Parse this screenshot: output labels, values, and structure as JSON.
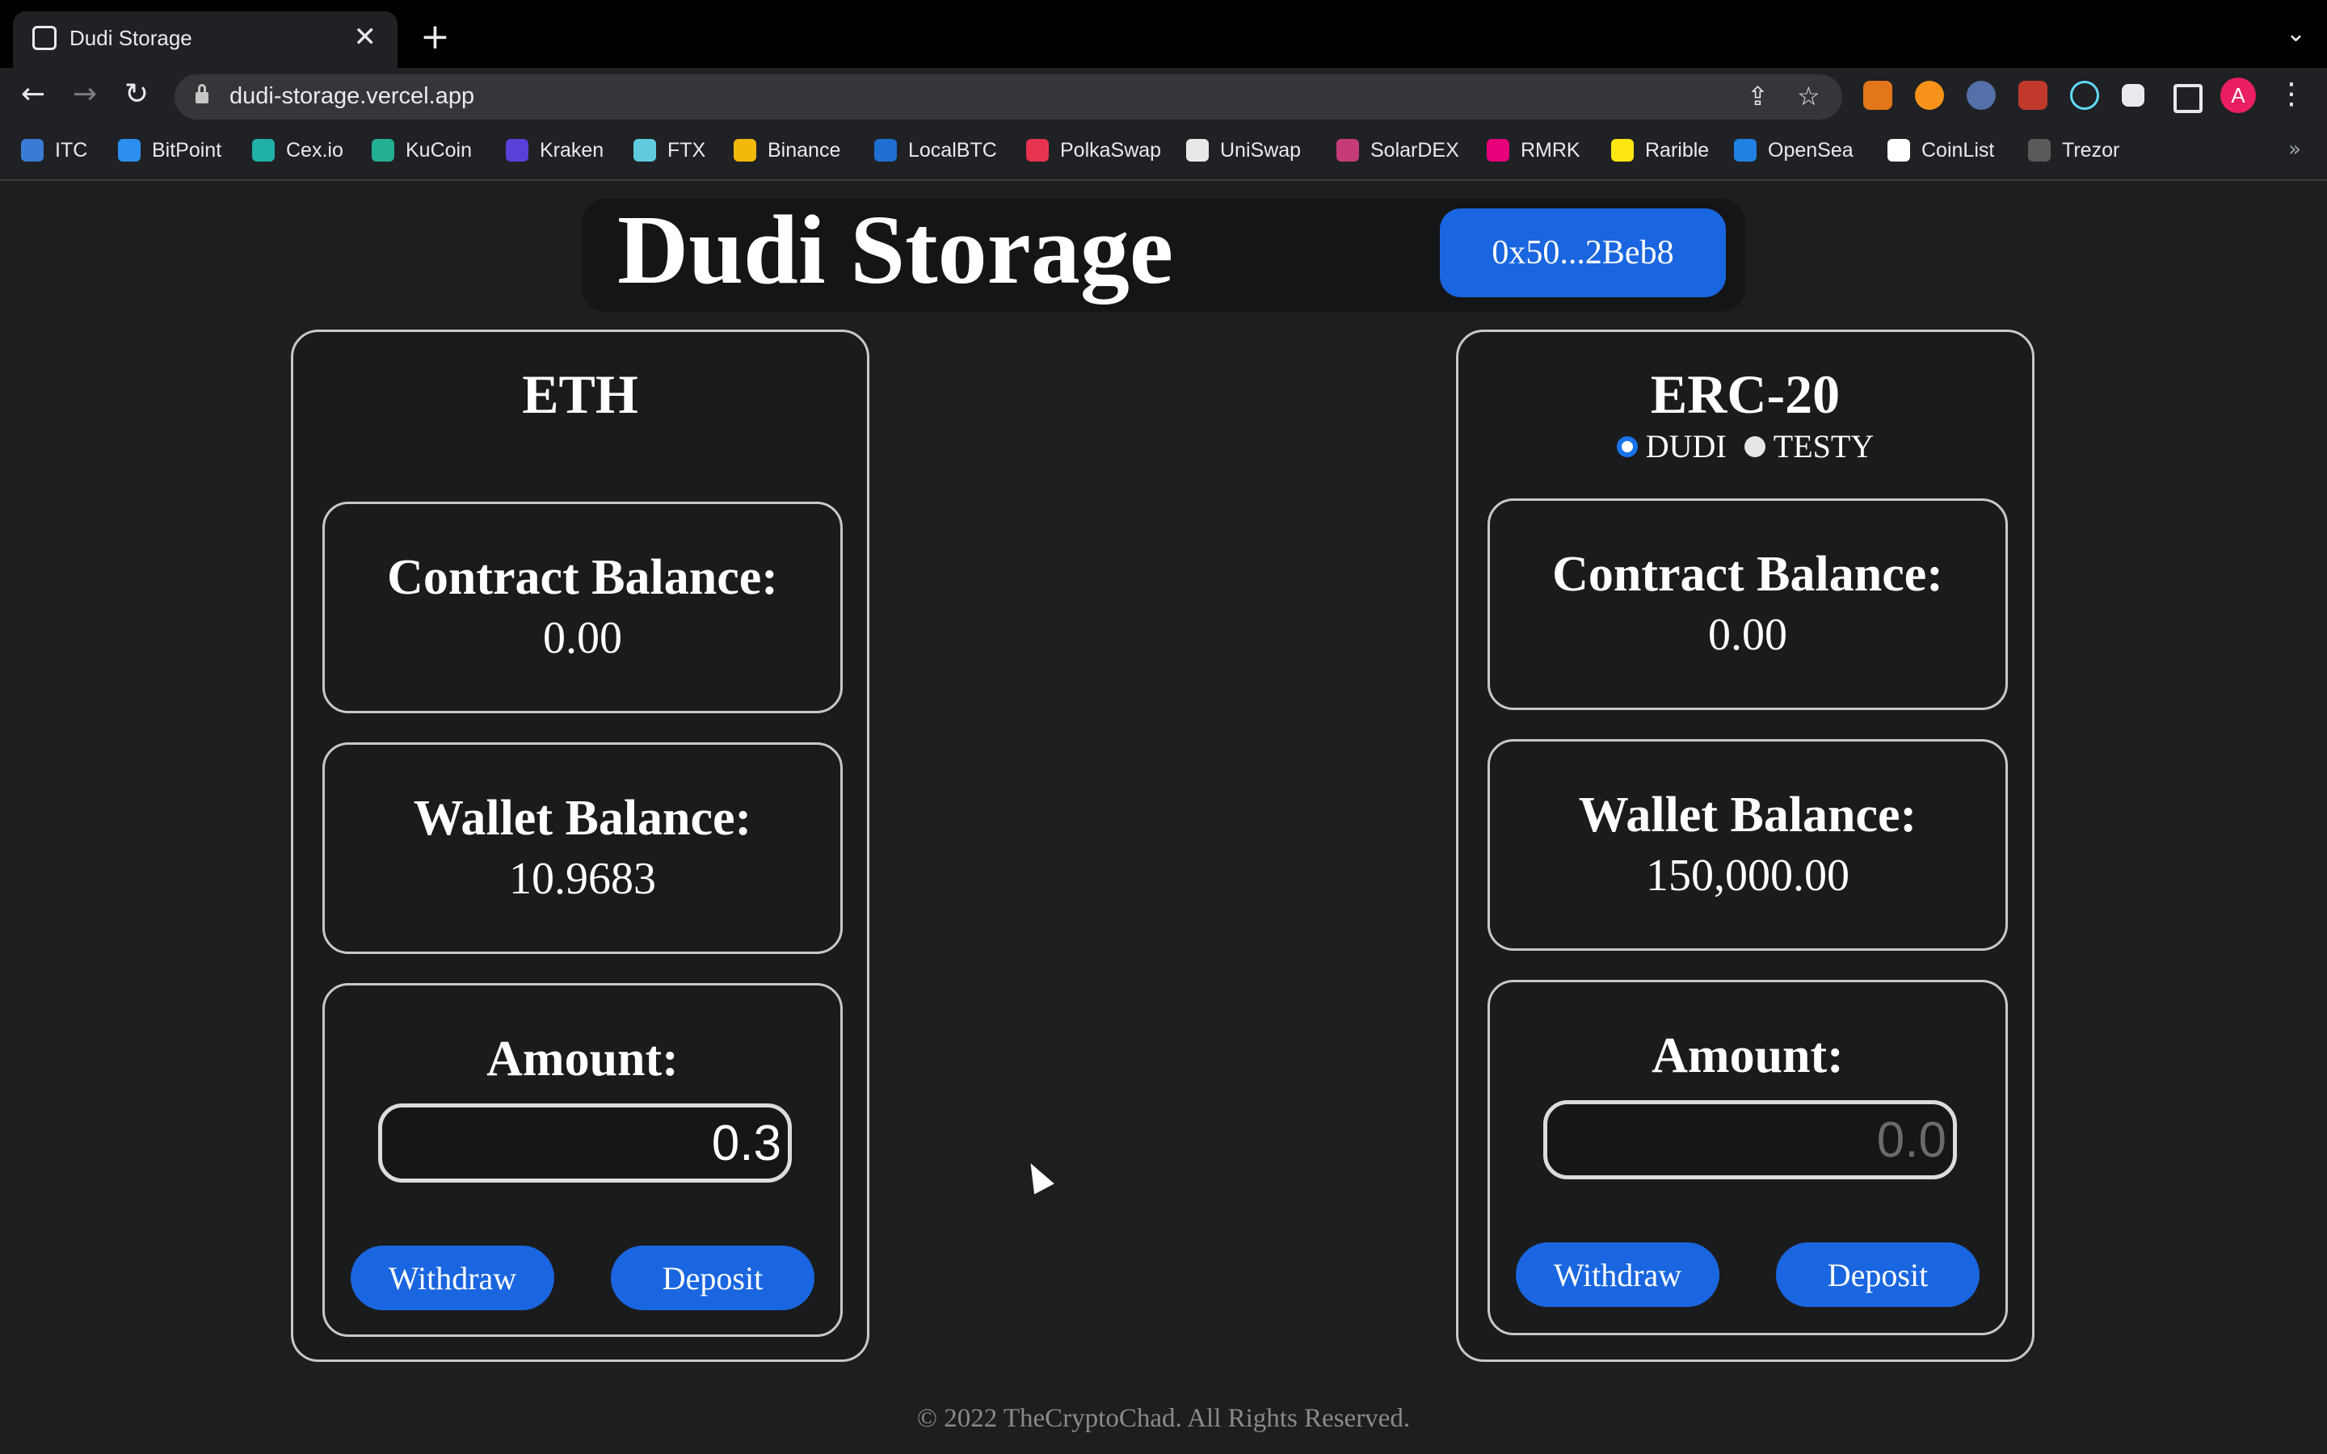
{
  "browser": {
    "tab_title": "Dudi Storage",
    "close_glyph": "✕",
    "new_tab_glyph": "+",
    "tab_menu_glyph": "⌄",
    "url": "dudi-storage.vercel.app",
    "back_glyph": "←",
    "forward_glyph": "→",
    "reload_glyph": "↻",
    "share_glyph": "⇪",
    "star_glyph": "☆",
    "menu_glyph": "⋮",
    "avatar_letter": "A",
    "bookmarks": [
      {
        "label": "ITC",
        "color": "#3a7bd5"
      },
      {
        "label": "BitPoint",
        "color": "#2b8ef0"
      },
      {
        "label": "Cex.io",
        "color": "#20b0a8"
      },
      {
        "label": "KuCoin",
        "color": "#23af91"
      },
      {
        "label": "Kraken",
        "color": "#5741d9"
      },
      {
        "label": "FTX",
        "color": "#5fcade"
      },
      {
        "label": "Binance",
        "color": "#f0b90b"
      },
      {
        "label": "LocalBTC",
        "color": "#1f6fd1"
      },
      {
        "label": "PolkaSwap",
        "color": "#e6334f"
      },
      {
        "label": "UniSwap",
        "color": "#e8e8e8"
      },
      {
        "label": "SolarDEX",
        "color": "#c43b77"
      },
      {
        "label": "RMRK",
        "color": "#e6007a"
      },
      {
        "label": "Rarible",
        "color": "#fee613"
      },
      {
        "label": "OpenSea",
        "color": "#2081e2"
      },
      {
        "label": "CoinList",
        "color": "#ffffff"
      },
      {
        "label": "Trezor",
        "color": "#5a5a5a"
      }
    ],
    "more_bookmarks_glyph": "»"
  },
  "header": {
    "title": "Dudi Storage",
    "wallet_address": "0x50...2Beb8"
  },
  "eth_panel": {
    "title": "ETH",
    "contract_label": "Contract Balance:",
    "contract_value": "0.00",
    "wallet_label": "Wallet Balance:",
    "wallet_value": "10.9683",
    "amount_label": "Amount:",
    "amount_value": "0.3",
    "withdraw_label": "Withdraw",
    "deposit_label": "Deposit"
  },
  "erc20_panel": {
    "title": "ERC-20",
    "token_options": [
      {
        "label": "DUDI",
        "selected": true
      },
      {
        "label": "TESTY",
        "selected": false
      }
    ],
    "contract_label": "Contract Balance:",
    "contract_value": "0.00",
    "wallet_label": "Wallet Balance:",
    "wallet_value": "150,000.00",
    "amount_label": "Amount:",
    "amount_placeholder": "0.0",
    "withdraw_label": "Withdraw",
    "deposit_label": "Deposit"
  },
  "footer": {
    "text": "© 2022 TheCryptoChad. All Rights Reserved."
  },
  "colors": {
    "accent": "#1a66e0",
    "background": "#1d1e20"
  }
}
